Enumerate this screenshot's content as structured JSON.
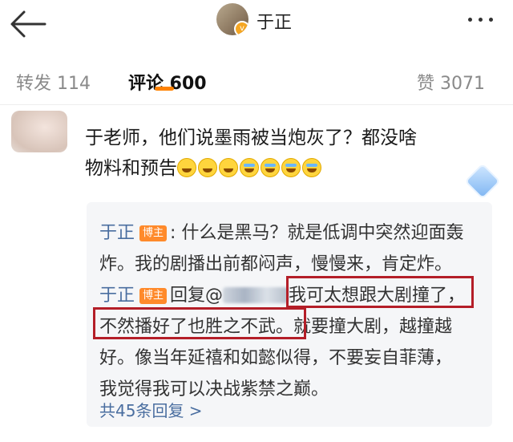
{
  "header": {
    "title": "于正",
    "verified_mark": "v"
  },
  "tabs": [
    {
      "label": "转发 114",
      "active": false
    },
    {
      "label": "评论 600",
      "active": true
    },
    {
      "label": "赞 3071",
      "active": false
    }
  ],
  "comment": {
    "text_line1": "于老师，他们说墨雨被当炮灰了？都没啥",
    "text_line2": "物料和预告",
    "emojis": [
      "laugh-cry-emoji",
      "laugh-cry-emoji",
      "laugh-cry-emoji",
      "cry-emoji",
      "cry-emoji",
      "cry-emoji",
      "cry-emoji"
    ]
  },
  "replies": {
    "reply1": {
      "user": "于正",
      "badge": "博主",
      "line1": ": 什么是黑马？就是低调中突然迎面轰",
      "line2": "炸。我的剧播出前都闷声，慢慢来，肯定炸。"
    },
    "reply2": {
      "user": "于正",
      "badge": "博主",
      "reply_prefix": "回复@",
      "line1_text": "我可太想跟大剧撞了，",
      "line2_a": "不然播好了也胜之不武。",
      "line2_b": "就要撞大剧，越撞越",
      "line3": "好。像当年延禧和如懿似得，不要妄自菲薄，",
      "line4": "我觉得我可以决战紫禁之巅。"
    },
    "more_label": "共45条回复 >"
  },
  "colors": {
    "accent": "#ff8200",
    "link": "#4a6ea0",
    "highlight": "#b41e28",
    "badge": "#ff8a2b"
  }
}
